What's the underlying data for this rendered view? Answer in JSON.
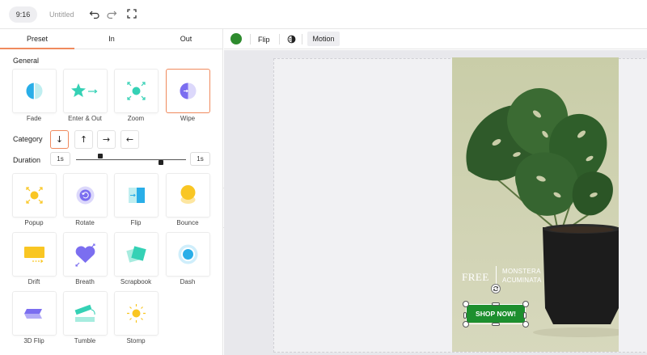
{
  "topbar": {
    "ratio": "9:16",
    "title": "Untitled",
    "undo_icon": "undo-icon",
    "redo_icon": "redo-icon",
    "fullscreen_icon": "fullscreen-icon"
  },
  "tabs": [
    {
      "label": "Preset",
      "active": true
    },
    {
      "label": "In",
      "active": false
    },
    {
      "label": "Out",
      "active": false
    }
  ],
  "general": {
    "title": "General",
    "items": [
      {
        "label": "Fade",
        "icon": "fade-icon"
      },
      {
        "label": "Enter & Out",
        "icon": "enter-out-icon"
      },
      {
        "label": "Zoom",
        "icon": "zoom-icon"
      },
      {
        "label": "Wipe",
        "icon": "wipe-icon",
        "selected": true
      }
    ]
  },
  "category": {
    "title": "Category",
    "directions": [
      "↓",
      "↑",
      "→",
      "←"
    ]
  },
  "duration": {
    "title": "Duration",
    "start": "1s",
    "end": "1s"
  },
  "presets": [
    {
      "label": "Popup",
      "icon": "popup-icon"
    },
    {
      "label": "Rotate",
      "icon": "rotate-icon"
    },
    {
      "label": "Flip",
      "icon": "flip-icon"
    },
    {
      "label": "Bounce",
      "icon": "bounce-icon"
    },
    {
      "label": "Drift",
      "icon": "drift-icon"
    },
    {
      "label": "Breath",
      "icon": "breath-icon"
    },
    {
      "label": "Scrapbook",
      "icon": "scrapbook-icon"
    },
    {
      "label": "Dash",
      "icon": "dash-icon"
    },
    {
      "label": "3D Flip",
      "icon": "3d-flip-icon"
    },
    {
      "label": "Tumble",
      "icon": "tumble-icon"
    },
    {
      "label": "Stomp",
      "icon": "stomp-icon"
    }
  ],
  "toolbar": {
    "color": "#2e8b2e",
    "flip_label": "Flip",
    "opacity_icon": "opacity-icon",
    "motion_label": "Motion"
  },
  "canvas": {
    "free_text": "FREE",
    "product_line1": "MONSTERA",
    "product_line2": "ACUMINATA",
    "button_text": "SHOP NOW!",
    "button_color": "#1d8f2e"
  },
  "colors": {
    "accent": "#f08a5d",
    "teal": "#35d1b5",
    "purple": "#7b6ef0",
    "yellow": "#f9c623",
    "blue": "#29aee8"
  }
}
